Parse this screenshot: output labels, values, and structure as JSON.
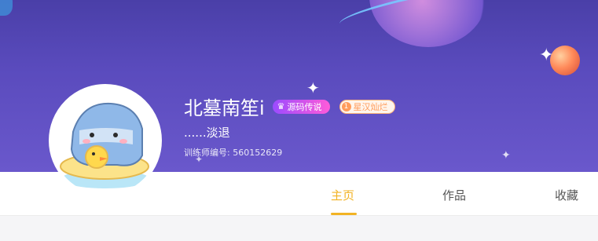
{
  "profile": {
    "username": "北墓南笙i",
    "bio": "......淡退",
    "trainer_label": "训练师编号:",
    "trainer_id": "560152629",
    "badges": {
      "source_legend": "源码传说",
      "rank_number": "1",
      "rank_label": "星汉灿烂"
    }
  },
  "tabs": [
    {
      "label": "主页",
      "active": true
    },
    {
      "label": "作品",
      "active": false
    },
    {
      "label": "收藏",
      "active": false
    }
  ],
  "colors": {
    "banner": "#5a4bbd",
    "accent": "#f2b324",
    "badge_purple": "#9b4bff",
    "badge_orange": "#ff9c5b"
  },
  "icons": {
    "crown": "crown-icon",
    "sparkle": "sparkle-icon",
    "avatar": "shark-avatar"
  }
}
